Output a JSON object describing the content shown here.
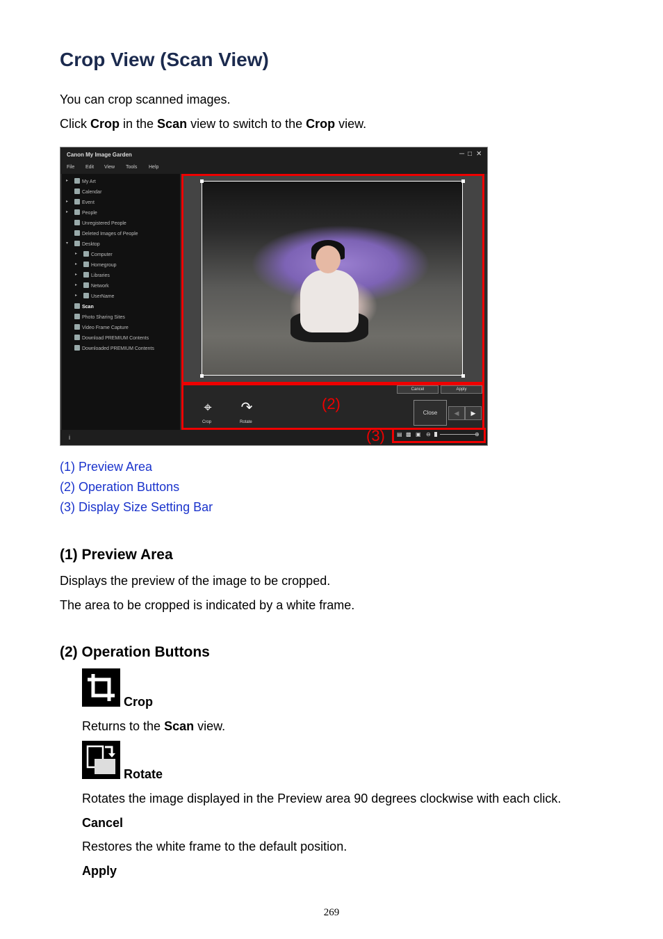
{
  "page": {
    "title": "Crop View (Scan View)",
    "intro1": "You can crop scanned images.",
    "intro2": {
      "pre": "Click ",
      "crop": "Crop",
      "mid1": " in the ",
      "scan": "Scan",
      "mid2": " view to switch to the ",
      "crop2": "Crop",
      "post": " view."
    },
    "links": [
      "(1) Preview Area",
      "(2) Operation Buttons",
      "(3) Display Size Setting Bar"
    ],
    "section1": {
      "heading": "(1) Preview Area",
      "line1": "Displays the preview of the image to be cropped.",
      "line2": "The area to be cropped is indicated by a white frame."
    },
    "section2": {
      "heading": "(2) Operation Buttons",
      "crop_label": "Crop",
      "crop_desc_pre": "Returns to the ",
      "crop_desc_bold": "Scan",
      "crop_desc_post": " view.",
      "rotate_label": "Rotate",
      "rotate_desc": "Rotates the image displayed in the Preview area 90 degrees clockwise with each click.",
      "cancel_label": "Cancel",
      "cancel_desc": "Restores the white frame to the default position.",
      "apply_label": "Apply"
    },
    "page_number": "269"
  },
  "screenshot": {
    "app_title": "Canon My Image Garden",
    "menu": [
      "File",
      "Edit",
      "View",
      "Tools",
      "Help"
    ],
    "tree": [
      {
        "label": "My Art",
        "level": 1,
        "arrow": "▸"
      },
      {
        "label": "Calendar",
        "level": 1,
        "arrow": ""
      },
      {
        "label": "Event",
        "level": 1,
        "arrow": "▸"
      },
      {
        "label": "People",
        "level": 1,
        "arrow": "▸"
      },
      {
        "label": "Unregistered People",
        "level": 1,
        "arrow": ""
      },
      {
        "label": "Deleted Images of People",
        "level": 1,
        "arrow": ""
      },
      {
        "label": "Desktop",
        "level": 1,
        "arrow": "▾"
      },
      {
        "label": "Computer",
        "level": 2,
        "arrow": "▸"
      },
      {
        "label": "Homegroup",
        "level": 2,
        "arrow": "▸"
      },
      {
        "label": "Libraries",
        "level": 2,
        "arrow": "▸"
      },
      {
        "label": "Network",
        "level": 2,
        "arrow": "▸"
      },
      {
        "label": "UserName",
        "level": 2,
        "arrow": "▸"
      },
      {
        "label": "Scan",
        "level": 1,
        "arrow": ""
      },
      {
        "label": "Photo Sharing Sites",
        "level": 1,
        "arrow": ""
      },
      {
        "label": "Video Frame Capture",
        "level": 1,
        "arrow": ""
      },
      {
        "label": "Download PREMIUM Contents",
        "level": 1,
        "arrow": ""
      },
      {
        "label": "Downloaded PREMIUM Contents",
        "level": 1,
        "arrow": ""
      }
    ],
    "cancel": "Cancel",
    "apply": "Apply",
    "crop": "Crop",
    "rotate": "Rotate",
    "close": "Close",
    "callout2": "(2)",
    "callout3": "(3)",
    "info_icon": "i"
  }
}
